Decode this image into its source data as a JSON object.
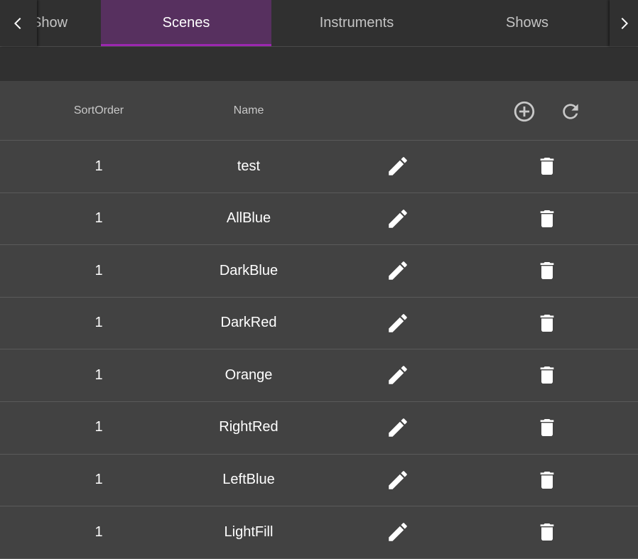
{
  "tabs": {
    "items": [
      {
        "label": "Show",
        "active": false
      },
      {
        "label": "Scenes",
        "active": true
      },
      {
        "label": "Instruments",
        "active": false
      },
      {
        "label": "Shows",
        "active": false
      }
    ]
  },
  "icons": {
    "scroll_left": "chevron-left-icon",
    "scroll_right": "chevron-right-icon",
    "add": "add-circle-outline-icon",
    "refresh": "refresh-icon",
    "edit": "pencil-icon",
    "delete": "trash-icon"
  },
  "colors": {
    "accent": "#9c27b0",
    "active_tab_bg": "#57305f",
    "background": "#424242",
    "tabbar_bg": "#303030"
  },
  "table": {
    "headers": {
      "sort_order": "SortOrder",
      "name": "Name"
    },
    "rows": [
      {
        "sort_order": "1",
        "name": "test"
      },
      {
        "sort_order": "1",
        "name": "AllBlue"
      },
      {
        "sort_order": "1",
        "name": "DarkBlue"
      },
      {
        "sort_order": "1",
        "name": "DarkRed"
      },
      {
        "sort_order": "1",
        "name": "Orange"
      },
      {
        "sort_order": "1",
        "name": "RightRed"
      },
      {
        "sort_order": "1",
        "name": "LeftBlue"
      },
      {
        "sort_order": "1",
        "name": "LightFill"
      }
    ]
  }
}
